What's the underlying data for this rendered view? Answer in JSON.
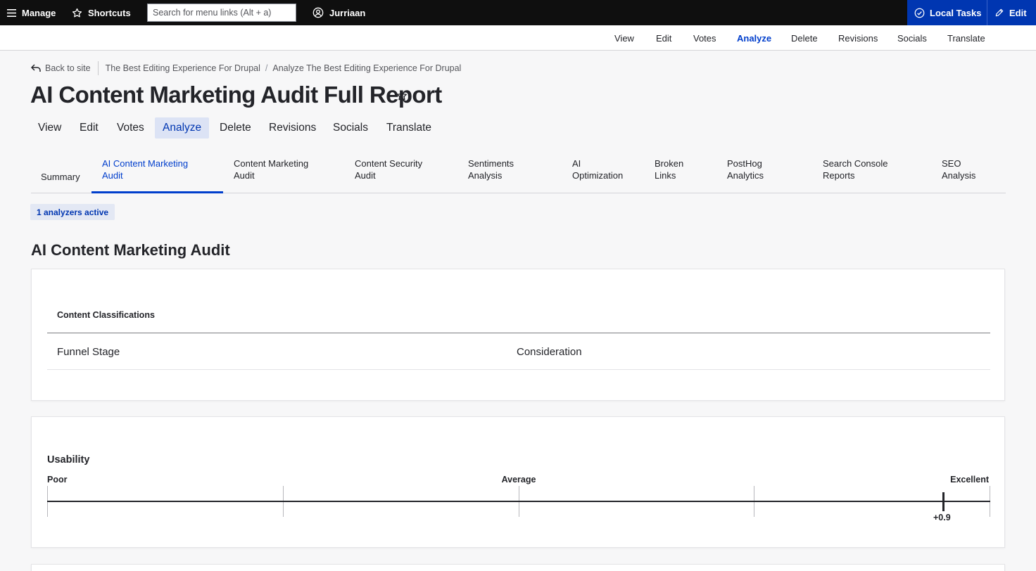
{
  "toolbar": {
    "manage": "Manage",
    "shortcuts": "Shortcuts",
    "search_placeholder": "Search for menu links (Alt + a)",
    "user": "Jurriaan",
    "local_tasks": "Local Tasks",
    "edit": "Edit"
  },
  "tray": {
    "items": [
      "View",
      "Edit",
      "Votes",
      "Analyze",
      "Delete",
      "Revisions",
      "Socials",
      "Translate"
    ],
    "active": "Analyze"
  },
  "breadcrumb": {
    "back": "Back to site",
    "items": [
      "The Best Editing Experience For Drupal",
      "Analyze The Best Editing Experience For Drupal"
    ],
    "separator": "/"
  },
  "page": {
    "title": "AI Content Marketing Audit Full Report"
  },
  "primary_tabs": {
    "items": [
      "View",
      "Edit",
      "Votes",
      "Analyze",
      "Delete",
      "Revisions",
      "Socials",
      "Translate"
    ],
    "active": "Analyze"
  },
  "secondary_tabs": {
    "items": [
      [
        "Summary"
      ],
      [
        "AI Content Marketing",
        "Audit"
      ],
      [
        "Content Marketing",
        "Audit"
      ],
      [
        "Content Security",
        "Audit"
      ],
      [
        "Sentiments",
        "Analysis"
      ],
      [
        "AI",
        "Optimization"
      ],
      [
        "Broken",
        "Links"
      ],
      [
        "PostHog",
        "Analytics"
      ],
      [
        "Search Console",
        "Reports"
      ],
      [
        "SEO",
        "Analysis"
      ]
    ],
    "active_index": 1
  },
  "badge": "1 analyzers active",
  "section_title": "AI Content Marketing Audit",
  "classifications": {
    "heading": "Content Classifications",
    "rows": [
      {
        "label": "Funnel Stage",
        "value": "Consideration"
      }
    ]
  },
  "usability": {
    "title": "Usability",
    "low_label": "Poor",
    "mid_label": "Average",
    "high_label": "Excellent",
    "score": 0.9,
    "score_label": "+0.9",
    "range": [
      -1,
      1
    ]
  },
  "colors": {
    "accent": "#003ecc",
    "toolbar": "#0f0f0f",
    "local_tasks_bg": "#0036b1"
  }
}
